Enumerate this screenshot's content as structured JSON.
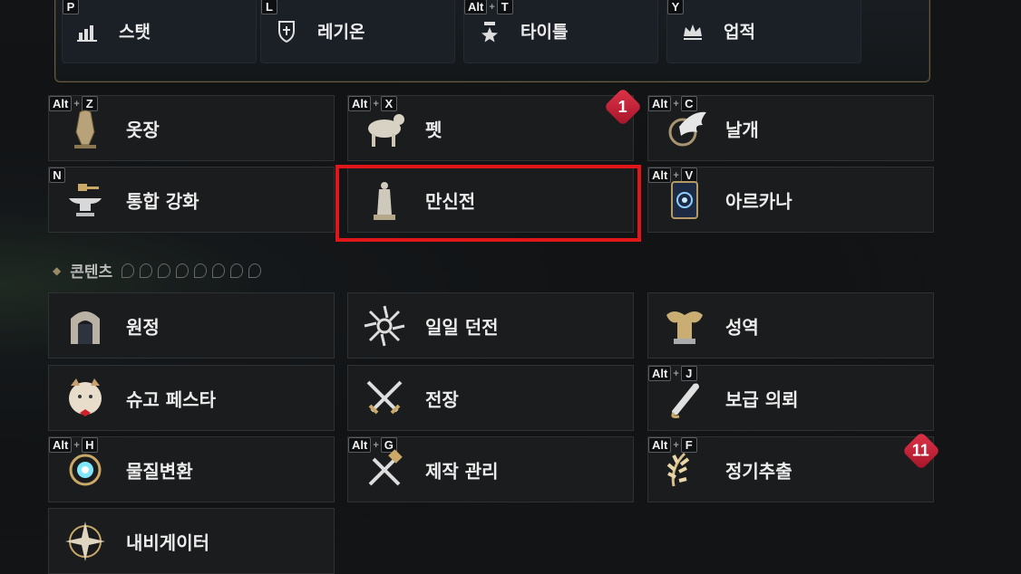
{
  "top_buttons": [
    {
      "hotkey": [
        "P"
      ],
      "label": "스탯",
      "icon": "stats-icon"
    },
    {
      "hotkey": [
        "L"
      ],
      "label": "레기온",
      "icon": "legion-shield-icon"
    },
    {
      "hotkey": [
        "Alt",
        "T"
      ],
      "label": "타이틀",
      "icon": "title-star-icon"
    },
    {
      "hotkey": [
        "Y"
      ],
      "label": "업적",
      "icon": "achievement-crown-icon"
    }
  ],
  "grid1": [
    {
      "hotkey": [
        "Alt",
        "Z"
      ],
      "label": "옷장",
      "icon": "wardrobe-icon"
    },
    {
      "hotkey": [
        "Alt",
        "X"
      ],
      "label": "펫",
      "icon": "pet-icon",
      "badge": "1"
    },
    {
      "hotkey": [
        "Alt",
        "C"
      ],
      "label": "날개",
      "icon": "wings-icon"
    },
    {
      "hotkey": [
        "N"
      ],
      "label": "통합 강화",
      "icon": "anvil-icon"
    },
    {
      "hotkey": [],
      "label": "만신전",
      "icon": "pantheon-statue-icon"
    },
    {
      "hotkey": [
        "Alt",
        "V"
      ],
      "label": "아르카나",
      "icon": "arcana-card-icon"
    }
  ],
  "section": {
    "title": "콘텐츠"
  },
  "grid2": [
    {
      "hotkey": [],
      "label": "원정",
      "icon": "expedition-gate-icon"
    },
    {
      "hotkey": [],
      "label": "일일 던전",
      "icon": "daily-dungeon-icon"
    },
    {
      "hotkey": [],
      "label": "성역",
      "icon": "sanctuary-icon"
    },
    {
      "hotkey": [],
      "label": "슈고 페스타",
      "icon": "shugo-icon"
    },
    {
      "hotkey": [],
      "label": "전장",
      "icon": "battlefield-swords-icon"
    },
    {
      "hotkey": [
        "Alt",
        "J"
      ],
      "label": "보급 의뢰",
      "icon": "supply-scroll-icon"
    },
    {
      "hotkey": [
        "Alt",
        "H"
      ],
      "label": "물질변환",
      "icon": "transmutation-orb-icon"
    },
    {
      "hotkey": [
        "Alt",
        "G"
      ],
      "label": "제작 관리",
      "icon": "crafting-tools-icon"
    },
    {
      "hotkey": [
        "Alt",
        "F"
      ],
      "label": "정기추출",
      "icon": "extraction-laurel-icon",
      "badge": "11"
    },
    {
      "hotkey": [],
      "label": "내비게이터",
      "icon": "navigator-compass-icon"
    }
  ],
  "colors": {
    "highlight": "#e0161b",
    "badge": "#c8243a",
    "panel_border": "#6a5a3a"
  }
}
